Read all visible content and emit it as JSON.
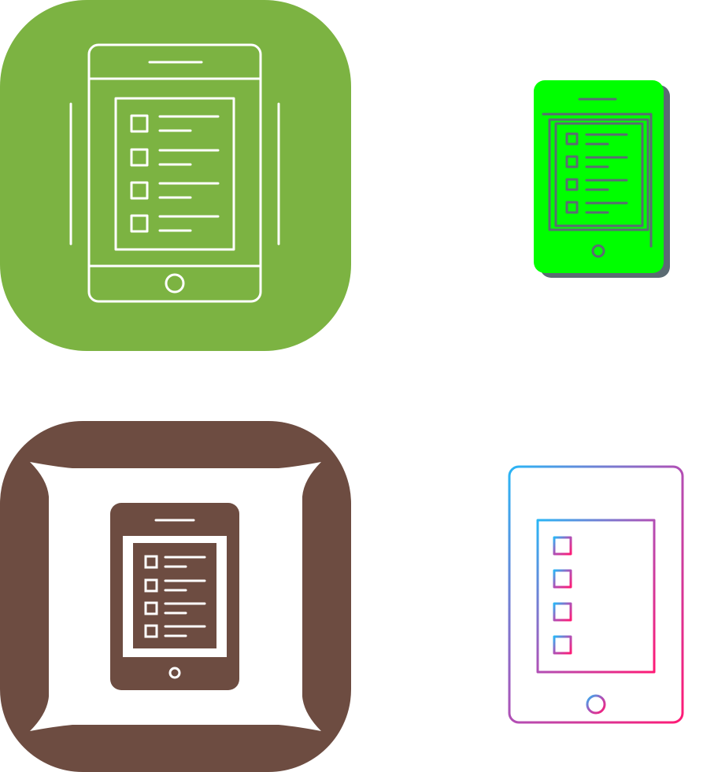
{
  "icons": [
    {
      "name": "tablet-checklist-line-icon-green-rounded",
      "style": "white line art on rounded green square",
      "colors": {
        "background": "#7cb342",
        "stroke": "#ffffff"
      }
    },
    {
      "name": "tablet-checklist-flat-icon-green",
      "style": "green flat tablet with grey offset outline",
      "colors": {
        "fill": "#00ff00",
        "shadow": "#5b6b73",
        "stroke": "#5b6b73"
      }
    },
    {
      "name": "tablet-checklist-glyph-icon-brown-cushion",
      "style": "brown tablet on white cushion inside brown rounded square",
      "colors": {
        "background": "#6d4c41",
        "cushion": "#ffffff",
        "glyph": "#6d4c41"
      }
    },
    {
      "name": "tablet-checklist-gradient-icon",
      "style": "gradient line art from blue to pink",
      "colors": {
        "gradient_start": "#29b6f6",
        "gradient_end": "#ff1a75"
      }
    }
  ]
}
